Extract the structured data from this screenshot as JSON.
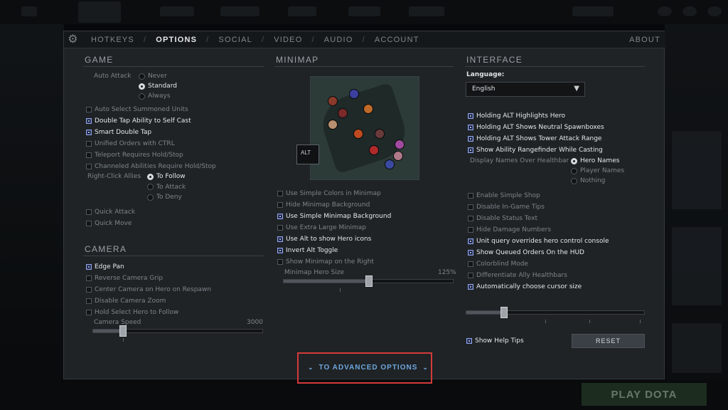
{
  "nav": {
    "tabs": [
      "HOTKEYS",
      "OPTIONS",
      "SOCIAL",
      "VIDEO",
      "AUDIO",
      "ACCOUNT"
    ],
    "active_tab": "OPTIONS",
    "about": "ABOUT",
    "separator": "/"
  },
  "game": {
    "title": "GAME",
    "auto_attack_label": "Auto Attack",
    "auto_attack_options": [
      "Never",
      "Standard",
      "Always"
    ],
    "auto_attack_selected": "Standard",
    "checkboxes": [
      {
        "label": "Auto Select Summoned Units",
        "checked": false
      },
      {
        "label": "Double Tap Ability to Self Cast",
        "checked": true
      },
      {
        "label": "Smart Double Tap",
        "checked": true
      },
      {
        "label": "Unified Orders with CTRL",
        "checked": false
      },
      {
        "label": "Teleport Requires Hold/Stop",
        "checked": false
      },
      {
        "label": "Channeled Abilities Require Hold/Stop",
        "checked": false
      }
    ],
    "right_click_label": "Right-Click Allies",
    "right_click_options": [
      "To Follow",
      "To Attack",
      "To Deny"
    ],
    "right_click_selected": "To Follow",
    "more_checkboxes": [
      {
        "label": "Quick Attack",
        "checked": false
      },
      {
        "label": "Quick Move",
        "checked": false
      }
    ]
  },
  "camera": {
    "title": "CAMERA",
    "checkboxes": [
      {
        "label": "Edge Pan",
        "checked": true
      },
      {
        "label": "Reverse Camera Grip",
        "checked": false
      },
      {
        "label": "Center Camera on Hero on Respawn",
        "checked": false
      },
      {
        "label": "Disable Camera Zoom",
        "checked": false
      },
      {
        "label": "Hold Select Hero to Follow",
        "checked": false
      }
    ],
    "speed_label": "Camera Speed",
    "speed_value": "3000"
  },
  "minimap": {
    "title": "MINIMAP",
    "alt_key": "ALT",
    "checkboxes": [
      {
        "label": "Use Simple Colors in Minimap",
        "checked": false
      },
      {
        "label": "Hide Minimap Background",
        "checked": false
      },
      {
        "label": "Use Simple Minimap Background",
        "checked": true
      },
      {
        "label": "Use Extra Large Minimap",
        "checked": false
      },
      {
        "label": "Use Alt to show Hero icons",
        "checked": true
      },
      {
        "label": "Invert Alt Toggle",
        "checked": true
      },
      {
        "label": "Show Minimap on the Right",
        "checked": false
      }
    ],
    "hero_size_label": "Minimap Hero Size",
    "hero_size_value": "125%"
  },
  "interface": {
    "title": "INTERFACE",
    "language_label": "Language:",
    "language_value": "English",
    "checkboxes_top": [
      {
        "label": "Holding ALT Highlights Hero",
        "checked": true
      },
      {
        "label": "Holding ALT Shows Neutral Spawnboxes",
        "checked": true
      },
      {
        "label": "Holding ALT Shows Tower Attack Range",
        "checked": true
      },
      {
        "label": "Show Ability Rangefinder While Casting",
        "checked": true
      }
    ],
    "display_names_label": "Display Names Over Healthbar",
    "display_names_options": [
      "Hero Names",
      "Player Names",
      "Nothing"
    ],
    "display_names_selected": "Hero Names",
    "checkboxes_bottom": [
      {
        "label": "Enable Simple Shop",
        "checked": false
      },
      {
        "label": "Disable In-Game Tips",
        "checked": false
      },
      {
        "label": "Disable Status Text",
        "checked": false
      },
      {
        "label": "Hide Damage Numbers",
        "checked": false
      },
      {
        "label": "Unit query overrides hero control console",
        "checked": true
      },
      {
        "label": "Show Queued Orders On the HUD",
        "checked": true
      },
      {
        "label": "Colorblind Mode",
        "checked": false
      },
      {
        "label": "Differentiate Ally Healthbars",
        "checked": false
      },
      {
        "label": "Automatically choose cursor size",
        "checked": true
      }
    ],
    "help_tips": {
      "label": "Show Help Tips",
      "checked": true
    },
    "reset": "RESET"
  },
  "advanced": {
    "label": "TO ADVANCED OPTIONS",
    "chevron": "⌄"
  },
  "background": {
    "play_button": "PLAY DOTA"
  },
  "colors": {
    "panel": "#1f2326",
    "accent_checkbox": "#8ea0e0",
    "advanced_link": "#6fa6dd",
    "highlight_box": "#d33a3a"
  }
}
